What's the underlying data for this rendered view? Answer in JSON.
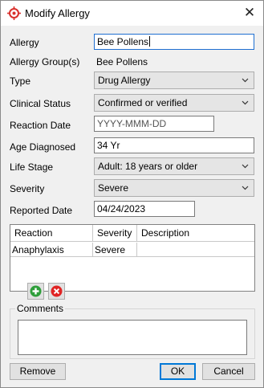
{
  "window": {
    "title": "Modify Allergy",
    "close_glyph": "✕",
    "icon": "allergy-target-icon"
  },
  "form": {
    "allergy_label": "Allergy",
    "allergy_value": "Bee Pollens",
    "allergy_group_label": "Allergy Group(s)",
    "allergy_group_value": "Bee Pollens",
    "type_label": "Type",
    "type_value": "Drug Allergy",
    "clinical_status_label": "Clinical Status",
    "clinical_status_value": "Confirmed or verified",
    "reaction_date_label": "Reaction Date",
    "reaction_date_placeholder": "YYYY-MMM-DD",
    "age_diagnosed_label": "Age Diagnosed",
    "age_diagnosed_value": "34 Yr",
    "life_stage_label": "Life Stage",
    "life_stage_value": "Adult: 18 years or older",
    "severity_label": "Severity",
    "severity_value": "Severe",
    "reported_date_label": "Reported Date",
    "reported_date_value": "04/24/2023"
  },
  "reactions": {
    "columns": [
      "Reaction",
      "Severity",
      "Description"
    ],
    "rows": [
      {
        "reaction": "Anaphylaxis",
        "severity": "Severe",
        "description": ""
      }
    ]
  },
  "comments": {
    "label": "Comments",
    "value": ""
  },
  "buttons": {
    "remove": "Remove",
    "ok": "OK",
    "cancel": "Cancel"
  },
  "colors": {
    "icon_red": "#d9302c",
    "add_green": "#2e9e3a",
    "delete_red": "#e02424",
    "focus_blue": "#1f6fd1"
  }
}
